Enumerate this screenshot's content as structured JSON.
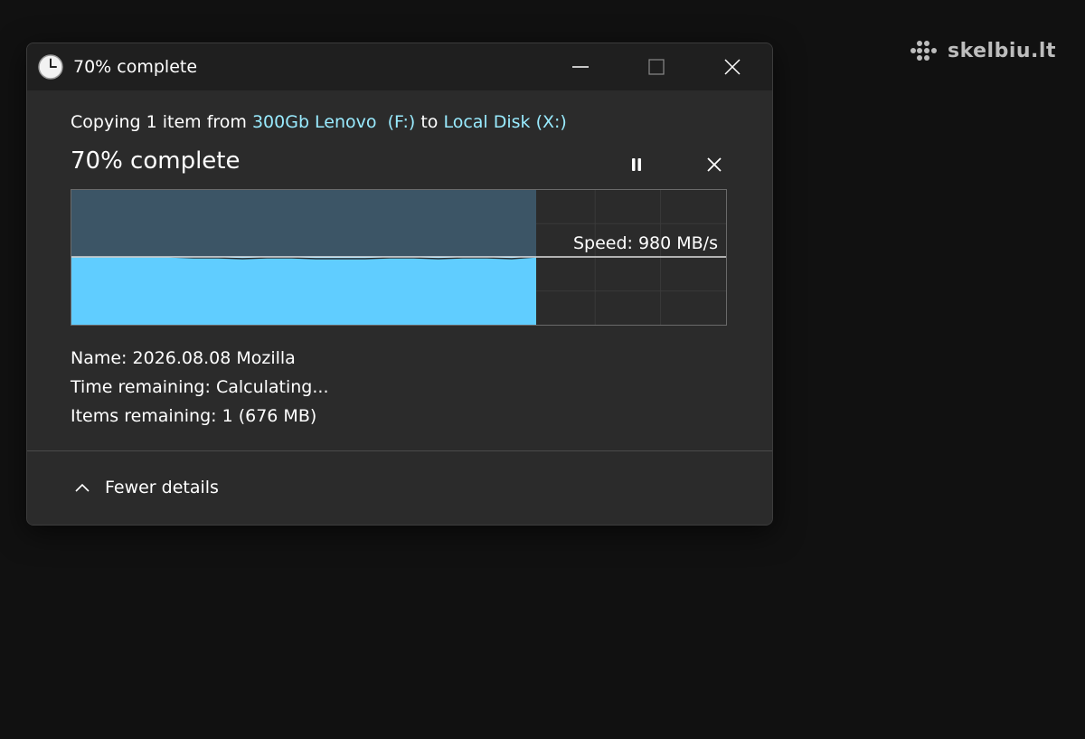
{
  "watermark": {
    "text": "skelbiu.lt"
  },
  "window": {
    "title": "70% complete",
    "icons": {
      "app": "clock-icon",
      "minimize": "minimize-icon",
      "maximize": "maximize-icon",
      "close": "close-icon"
    }
  },
  "copy": {
    "prefix": "Copying 1 item from ",
    "source": "300Gb Lenovo  (F:)",
    "middle": " to ",
    "destination": "Local Disk (X:)"
  },
  "status": {
    "percent_label": "70% complete",
    "progress": 0.71,
    "speed_label": "Speed: 980 MB/s",
    "controls": {
      "pause": "pause-icon",
      "cancel": "close-icon"
    }
  },
  "details": {
    "name_label": "Name:",
    "name_value": "2026.08.08 Mozilla",
    "time_label": "Time remaining:",
    "time_value": "Calculating...",
    "items_label": "Items remaining:",
    "items_value": "1 (676 MB)"
  },
  "footer": {
    "toggle_label": "Fewer details",
    "toggle_icon": "chevron-up-icon"
  },
  "colors": {
    "accent": "#99ebff",
    "graph_fill": "#60cdff",
    "graph_past": "#3c5566",
    "window_bg": "#2b2b2b",
    "titlebar_bg": "#1f1f1f"
  }
}
